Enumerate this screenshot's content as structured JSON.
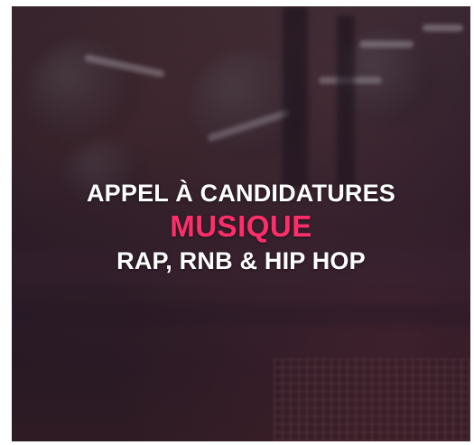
{
  "poster": {
    "line1": "APPEL À CANDIDATURES",
    "line2": "MUSIQUE",
    "line3": "RAP, RNB & HIP HOP"
  },
  "colors": {
    "accent": "#ff2e6a",
    "text": "#ffffff",
    "background": "#2b1f2b"
  }
}
